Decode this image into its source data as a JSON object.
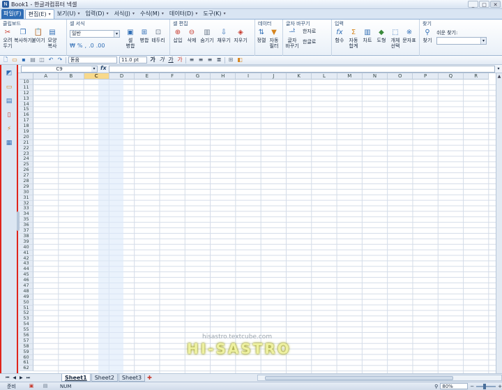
{
  "titlebar": {
    "title": "Book1 - 한글과컴퓨터 넥셀",
    "logo": "N",
    "min": "_",
    "max": "□",
    "close": "✕"
  },
  "menubar": {
    "file": "파일(F)",
    "items": [
      "편집(E)",
      "보기(U)",
      "입력(D)",
      "서식(J)",
      "수식(M)",
      "데이터(D)",
      "도구(K)"
    ]
  },
  "ribbon": {
    "clipboard": {
      "title": "클립보드",
      "cut": "오려\n두기",
      "copy": "복사하기",
      "paste": "붙이기",
      "format_copy": "모양\n복사"
    },
    "cell_format": {
      "title": "셀 서식",
      "number_format": "일반",
      "pct": "%",
      "comma": ",",
      "currency": "₩",
      "dec_inc": ".0",
      "dec_dec": ".00",
      "merge": "셀\n병합",
      "wrap": "병합",
      "border": "테두리"
    },
    "cell_edit": {
      "title": "셀 편집",
      "insert": "삽입",
      "delete": "삭제",
      "hide": "숨기기",
      "fill": "채우기",
      "erase": "지우기"
    },
    "data": {
      "title": "데이터",
      "sort": "정렬",
      "filter": "자동\n필터"
    },
    "char_convert": {
      "title": "글자 바꾸기",
      "char": "글자\n바꾸기",
      "hanja": "한자로",
      "hangul": "한글로"
    },
    "input": {
      "title": "입력",
      "func": "함수",
      "autosum": "자동\n합계",
      "chart": "차트",
      "shape": "도형",
      "object": "개체\n선택",
      "table": "문자표"
    },
    "find": {
      "title": "찾기",
      "find": "찾기",
      "easy_find": "쉬운 찾기:"
    }
  },
  "toolbar2": {
    "font": "돋움",
    "size": "11.0",
    "unit": "pt"
  },
  "formula": {
    "cell_ref": "C9",
    "fx": "fx",
    "value": ""
  },
  "grid": {
    "columns": [
      "A",
      "B",
      "C",
      "D",
      "E",
      "F",
      "G",
      "H",
      "I",
      "J",
      "K",
      "L",
      "M",
      "N",
      "O",
      "P",
      "Q",
      "R"
    ],
    "selected_col": "C",
    "first_row": 10,
    "last_row": 62
  },
  "sheets": {
    "tabs": [
      "Sheet1",
      "Sheet2",
      "Sheet3"
    ],
    "active": "Sheet1"
  },
  "watermark": {
    "url": "hisastro.textcube.com",
    "logo": "HI-SASTRO"
  },
  "status": {
    "ready": "준비",
    "num": "NUM",
    "zoom": "80%"
  },
  "colors": {
    "accent": "#2f6db5",
    "highlight_border": "#e0241b",
    "selected_header": "#f8d98b"
  }
}
